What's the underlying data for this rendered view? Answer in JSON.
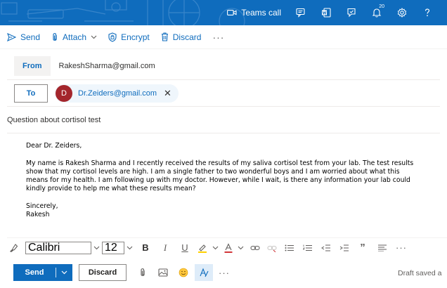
{
  "appbar": {
    "teams_label": "Teams call",
    "notification_badge": "20",
    "icons": [
      "teams-video-icon",
      "chat-icon",
      "word-icon",
      "feedback-icon",
      "notification-bell-icon",
      "settings-gear-icon",
      "help-icon"
    ]
  },
  "commands": {
    "send": "Send",
    "attach": "Attach",
    "encrypt": "Encrypt",
    "discard": "Discard",
    "more": "···"
  },
  "from": {
    "label": "From",
    "value": "RakeshSharma@gmail.com"
  },
  "to": {
    "label": "To",
    "recipient_initial": "D",
    "recipient_email": "Dr.Zeiders@gmail.com",
    "remove_symbol": "✕"
  },
  "subject": "Question about cortisol test",
  "body": {
    "greeting": "Dear Dr. Zeiders,",
    "paragraph": "My name is Rakesh Sharma and I recently received the results of my saliva cortisol test from your lab. The test results show that my cortisol levels are high. I am a single father to two wonderful boys and I am worried about what this means for my health. I am following up with my doctor. However, while I wait, is there any information your lab could kindly provide to help me what these results mean?",
    "closing": "Sincerely,",
    "signature": "Rakesh"
  },
  "format": {
    "font_name": "Calibri",
    "font_size": "12",
    "bold": "B",
    "italic": "I",
    "underline": "U",
    "quote": "”",
    "more": "···"
  },
  "actions": {
    "send": "Send",
    "discard": "Discard",
    "more": "···",
    "draft_status": "Draft saved a"
  },
  "colors": {
    "brand": "#0f6cbd",
    "avatar": "#a4262c",
    "highlight": "#ffd000",
    "font_color_underline": "#d13438"
  }
}
